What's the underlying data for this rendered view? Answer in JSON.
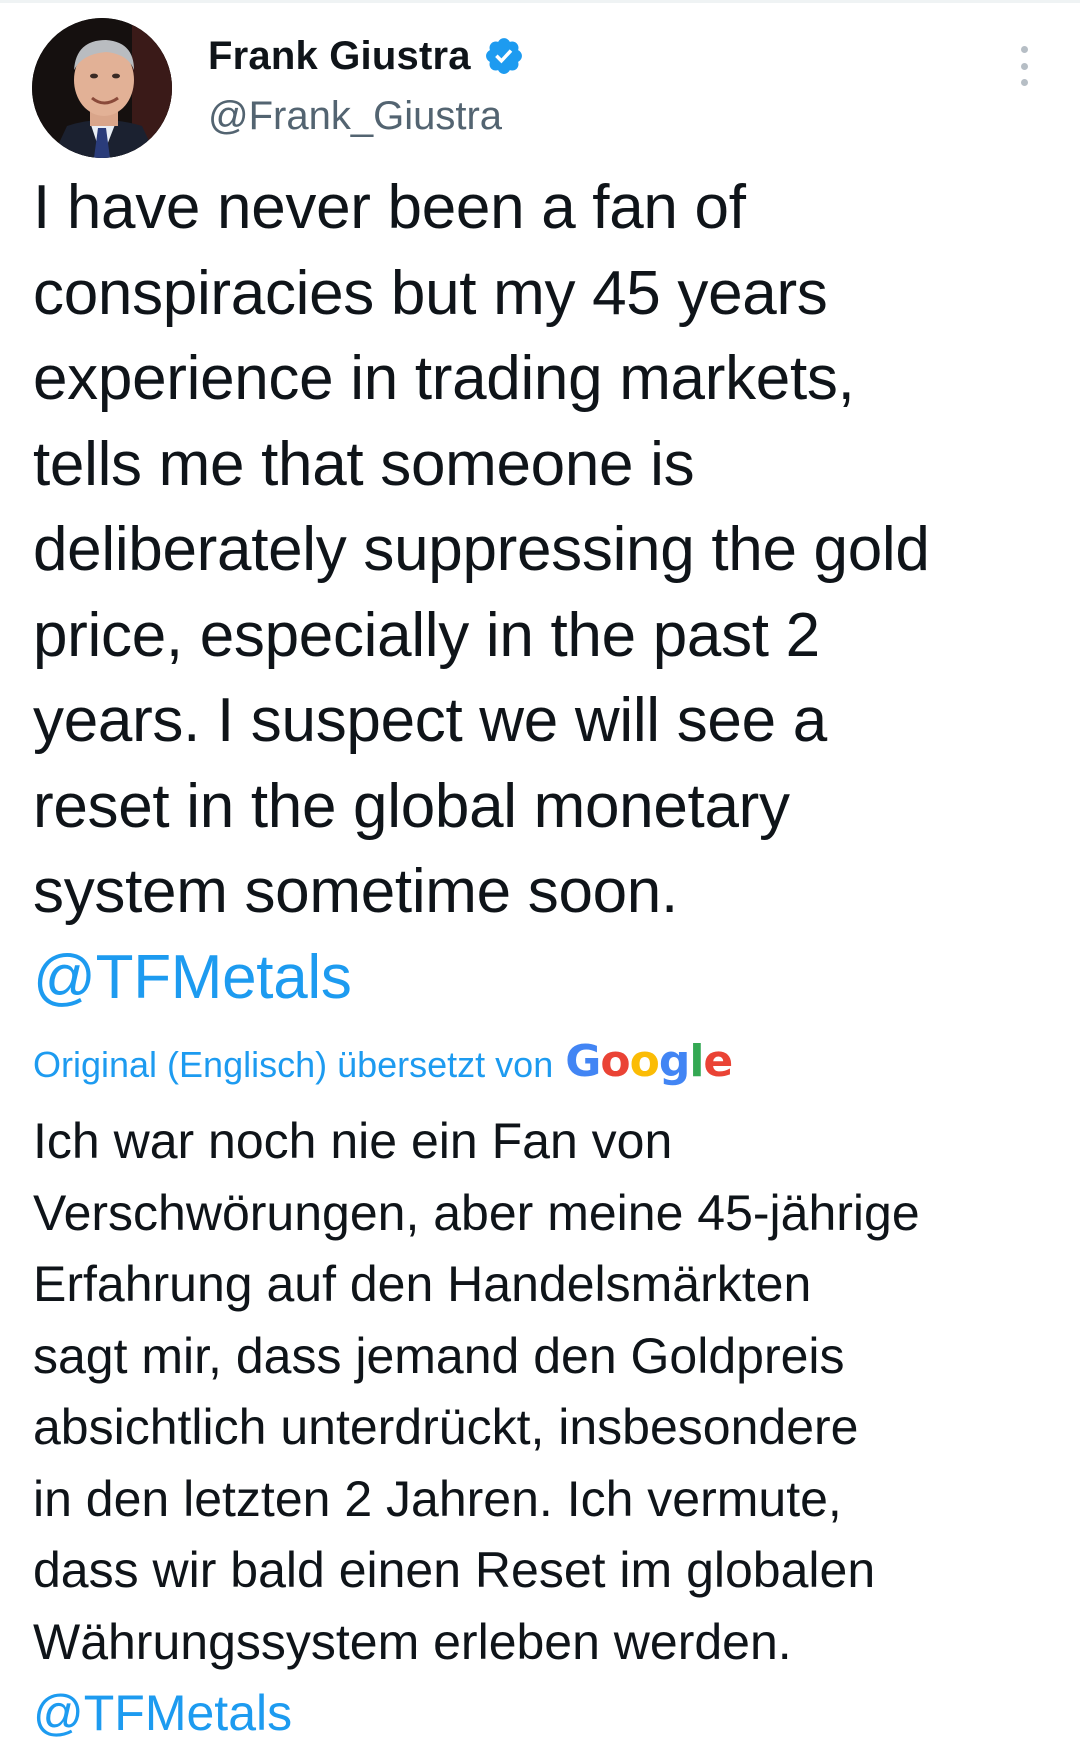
{
  "author": {
    "display_name": "Frank Giustra",
    "handle": "@Frank_Giustra",
    "verified_icon": "verified-badge-icon",
    "avatar": "profile-photo"
  },
  "tweet": {
    "lines": [
      "I have never been a fan of",
      "conspiracies but my 45 years",
      "experience in trading markets,",
      "tells me that someone is",
      "deliberately suppressing the gold",
      "price, especially in the past 2",
      "years. I suspect we will see a",
      "reset in the global monetary",
      "system sometime soon."
    ],
    "mention": "@TFMetals"
  },
  "translation": {
    "label": "Original (Englisch) übersetzt von",
    "provider": "Google",
    "lines": [
      "Ich war noch nie ein Fan von",
      "Verschwörungen, aber meine 45-jährige",
      "Erfahrung auf den Handelsmärkten",
      "sagt mir, dass jemand den Goldpreis",
      "absichtlich unterdrückt, insbesondere",
      "in den letzten 2 Jahren. Ich vermute,",
      "dass wir bald einen Reset im globalen",
      "Währungssystem erleben werden."
    ],
    "mention": "@TFMetals"
  },
  "colors": {
    "accent": "#1d9bf0",
    "text": "#0f1419",
    "secondary": "#536471"
  }
}
